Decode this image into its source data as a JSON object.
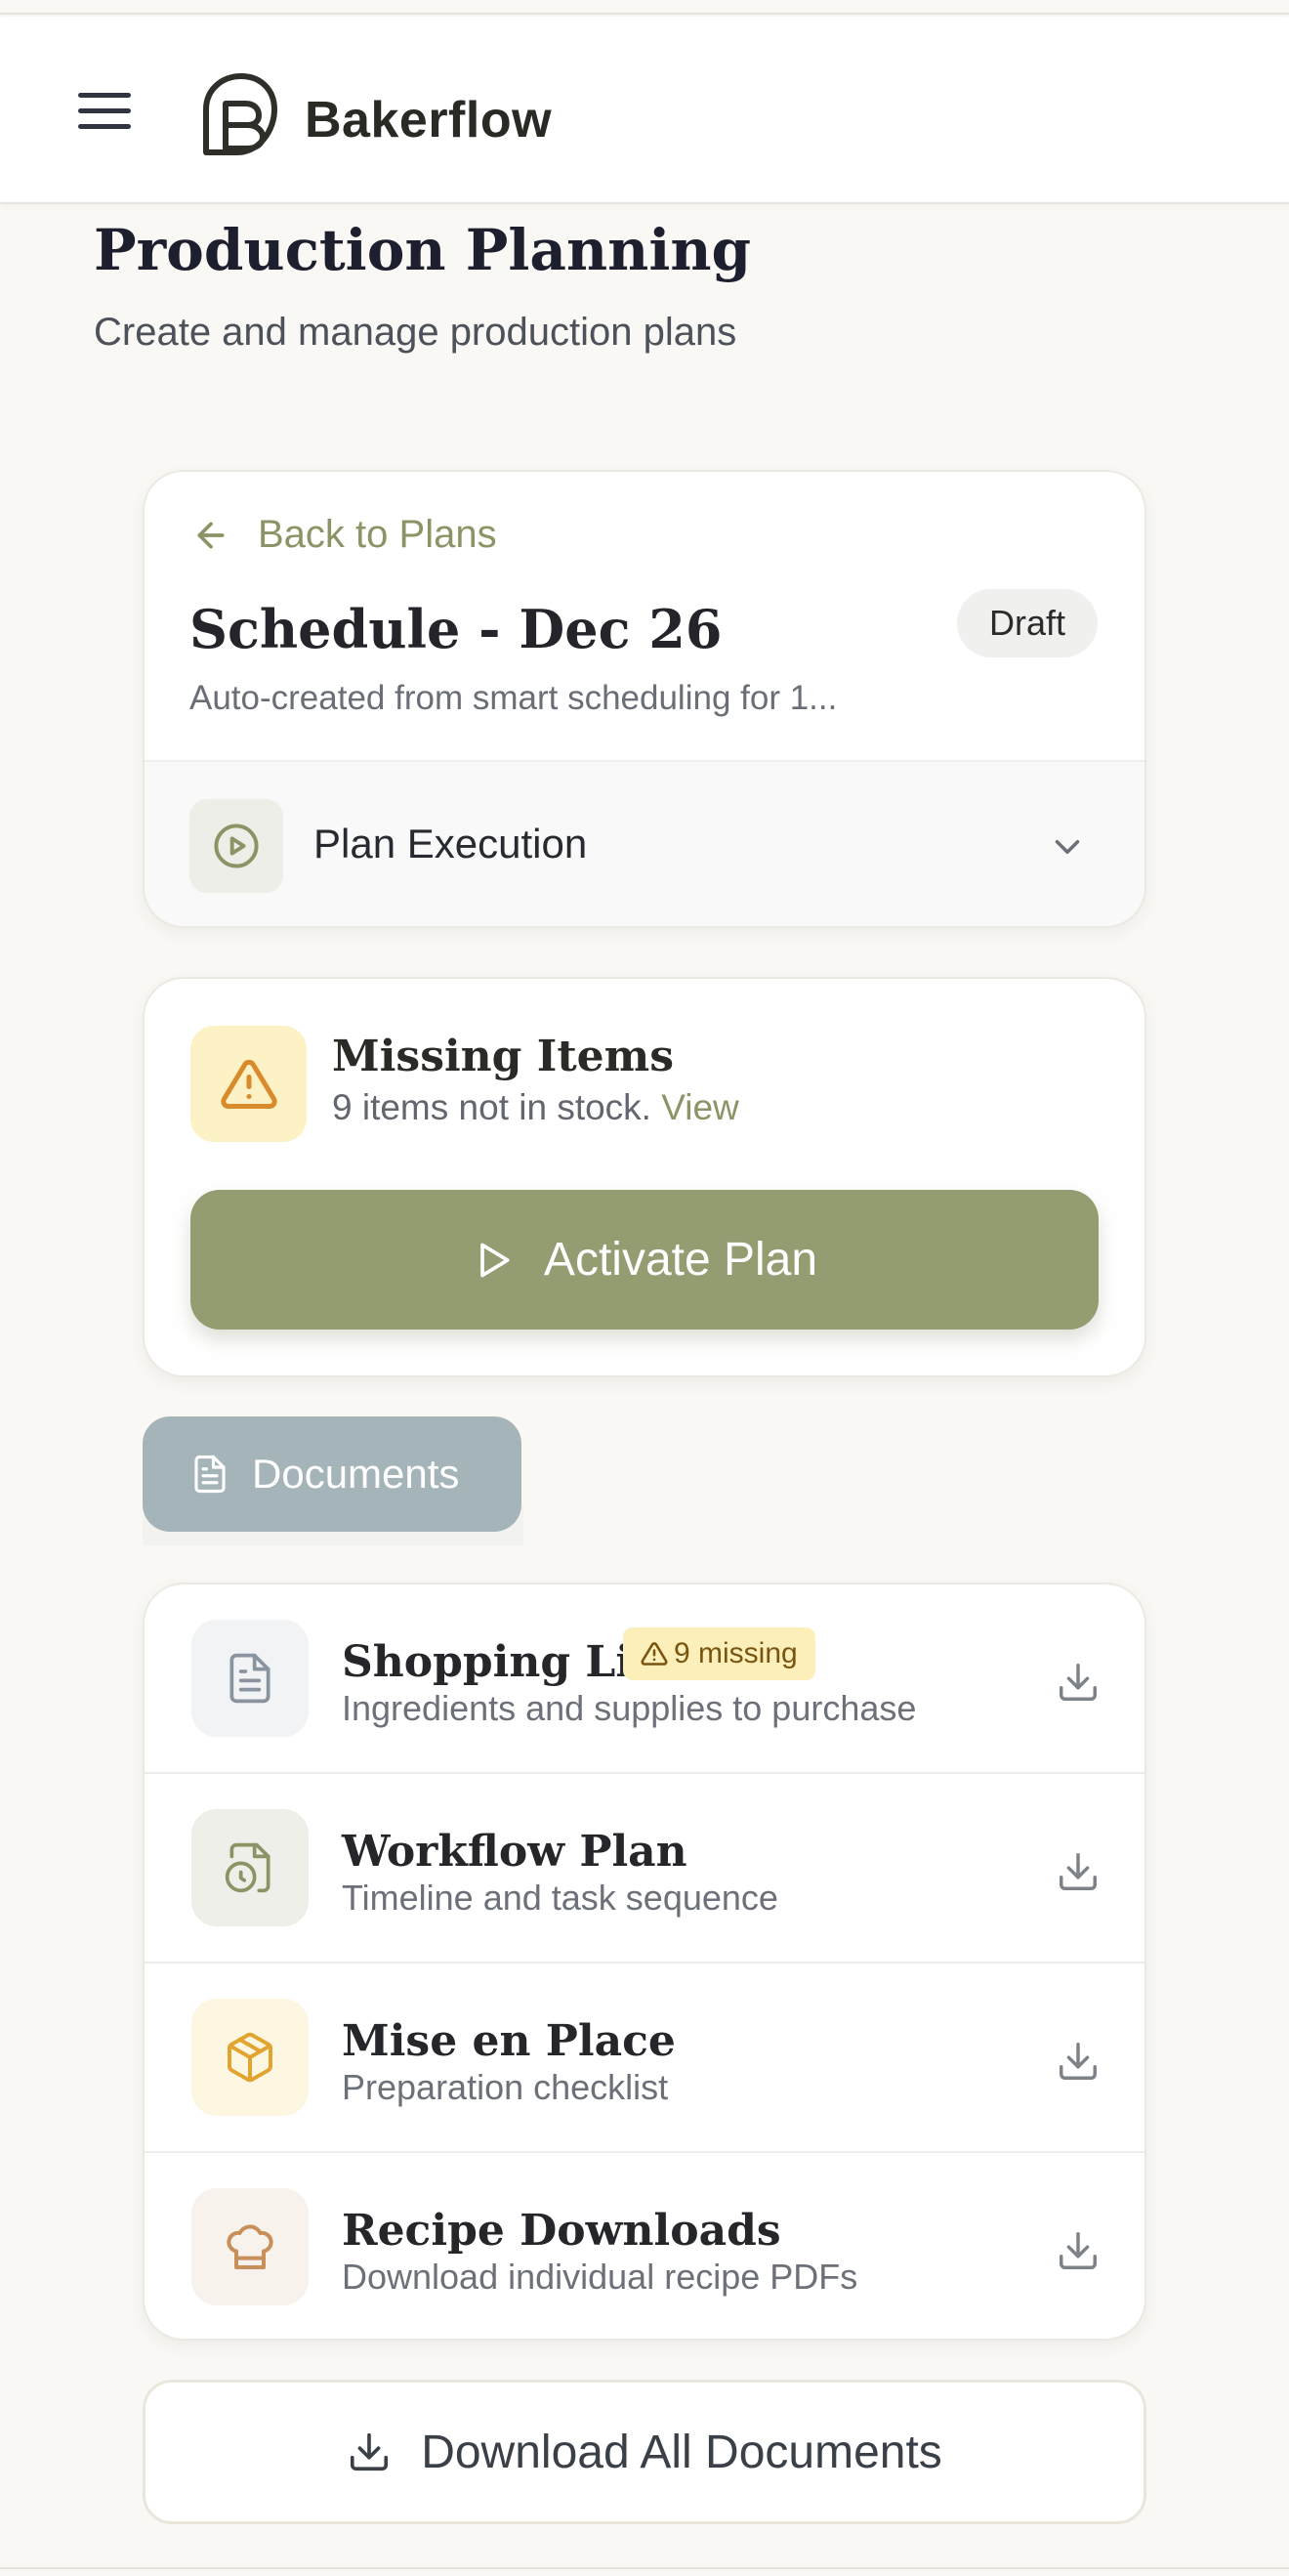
{
  "app": {
    "brand": "Bakerflow"
  },
  "page": {
    "title": "Production Planning",
    "subtitle": "Create and manage production plans"
  },
  "plan": {
    "back_label": "Back to Plans",
    "title": "Schedule - Dec 26",
    "status": "Draft",
    "description": "Auto-created from smart scheduling for 1...",
    "execution_label": "Plan Execution"
  },
  "missing": {
    "title": "Missing Items",
    "text": "9 items not in stock.",
    "link": "View"
  },
  "activate_label": "Activate Plan",
  "documents": {
    "tab_label": "Documents",
    "items": [
      {
        "title": "Shopping List",
        "subtitle": "Ingredients and supplies to purchase",
        "badge": "9 missing",
        "icon": "document-icon",
        "icon_bg": "#f1f3f5"
      },
      {
        "title": "Workflow Plan",
        "subtitle": "Timeline and task sequence",
        "icon": "file-clock-icon",
        "icon_bg": "#efefe9"
      },
      {
        "title": "Mise en Place",
        "subtitle": "Preparation checklist",
        "icon": "package-icon",
        "icon_bg": "#fdf7e2"
      },
      {
        "title": "Recipe Downloads",
        "subtitle": "Download individual recipe PDFs",
        "icon": "chef-hat-icon",
        "icon_bg": "#f7f2ec"
      }
    ],
    "download_all_label": "Download All Documents"
  },
  "colors": {
    "accent": "#949c72",
    "accent_text": "#8c9466",
    "warning_bg": "#fdf1c6",
    "warning_icon": "#d98a2b",
    "documents_tab": "#a4b4b8"
  }
}
